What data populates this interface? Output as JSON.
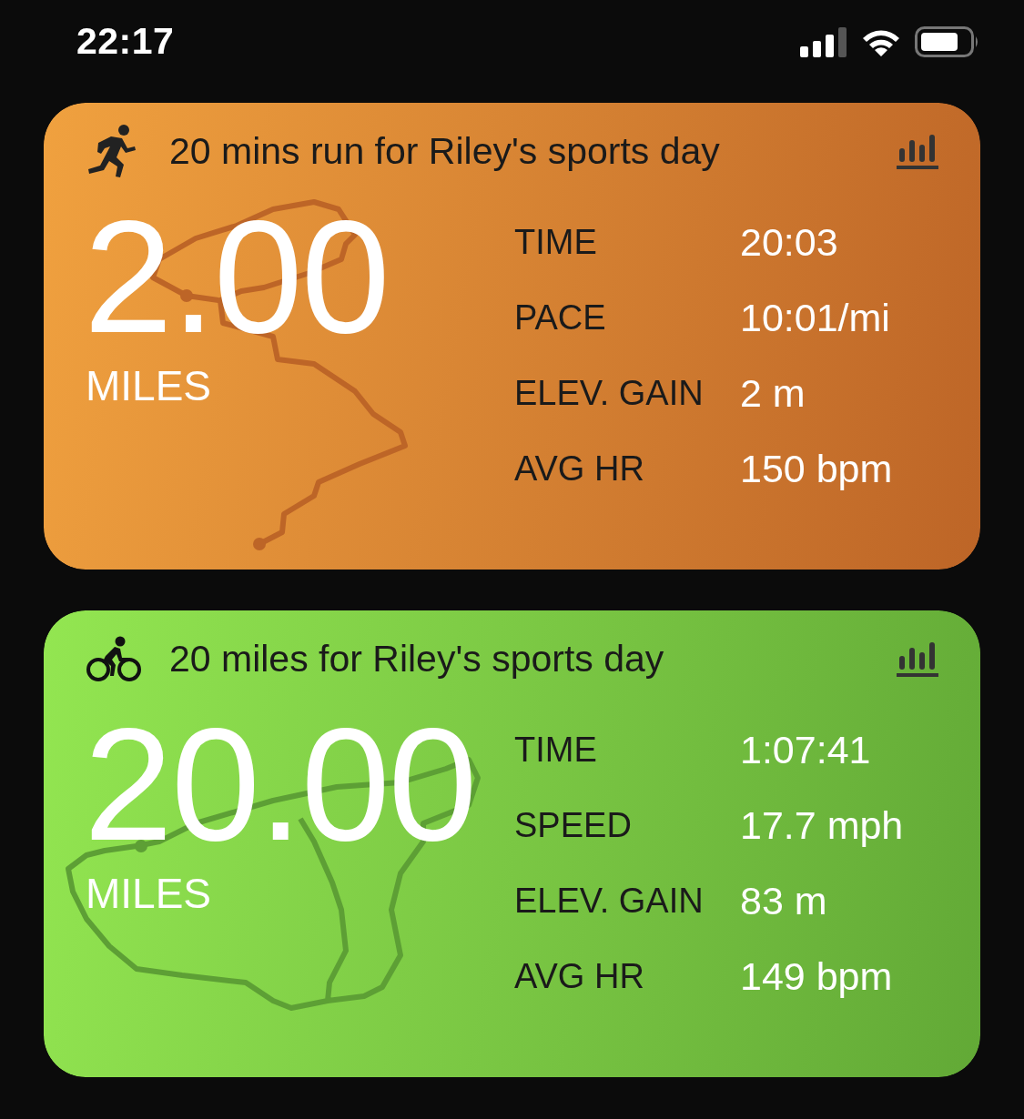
{
  "status_bar": {
    "time": "22:17"
  },
  "workouts": [
    {
      "kind": "run",
      "title": "20 mins run for Riley's sports day",
      "distance": "2.00",
      "unit": "MILES",
      "stats": [
        {
          "label": "TIME",
          "value": "20:03"
        },
        {
          "label": "PACE",
          "value": "10:01/mi"
        },
        {
          "label": "ELEV. GAIN",
          "value": "2 m"
        },
        {
          "label": "AVG HR",
          "value": "150 bpm"
        }
      ]
    },
    {
      "kind": "ride",
      "title": "20 miles for Riley's sports day",
      "distance": "20.00",
      "unit": "MILES",
      "stats": [
        {
          "label": "TIME",
          "value": "1:07:41"
        },
        {
          "label": "SPEED",
          "value": "17.7 mph"
        },
        {
          "label": "ELEV. GAIN",
          "value": "83 m"
        },
        {
          "label": "AVG HR",
          "value": "149 bpm"
        }
      ]
    }
  ]
}
